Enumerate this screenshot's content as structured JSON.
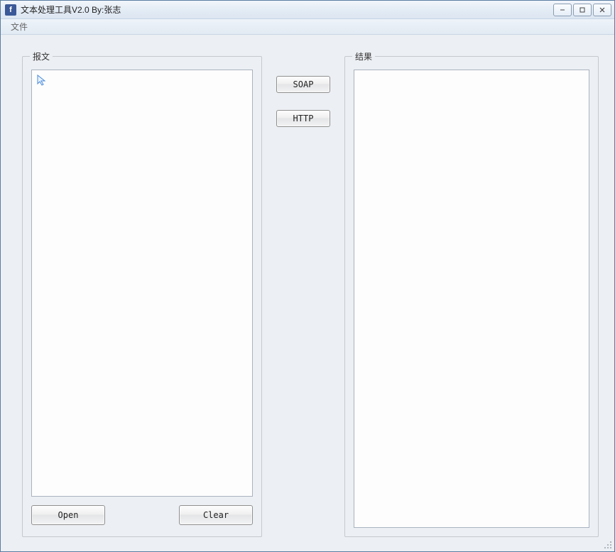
{
  "window": {
    "title": "文本处理工具V2.0 By:张志"
  },
  "menu": {
    "file": "文件"
  },
  "groups": {
    "input_legend": "报文",
    "output_legend": "结果"
  },
  "buttons": {
    "open": "Open",
    "clear": "Clear",
    "soap": "SOAP",
    "http": "HTTP"
  },
  "textareas": {
    "input_value": "",
    "output_value": ""
  }
}
